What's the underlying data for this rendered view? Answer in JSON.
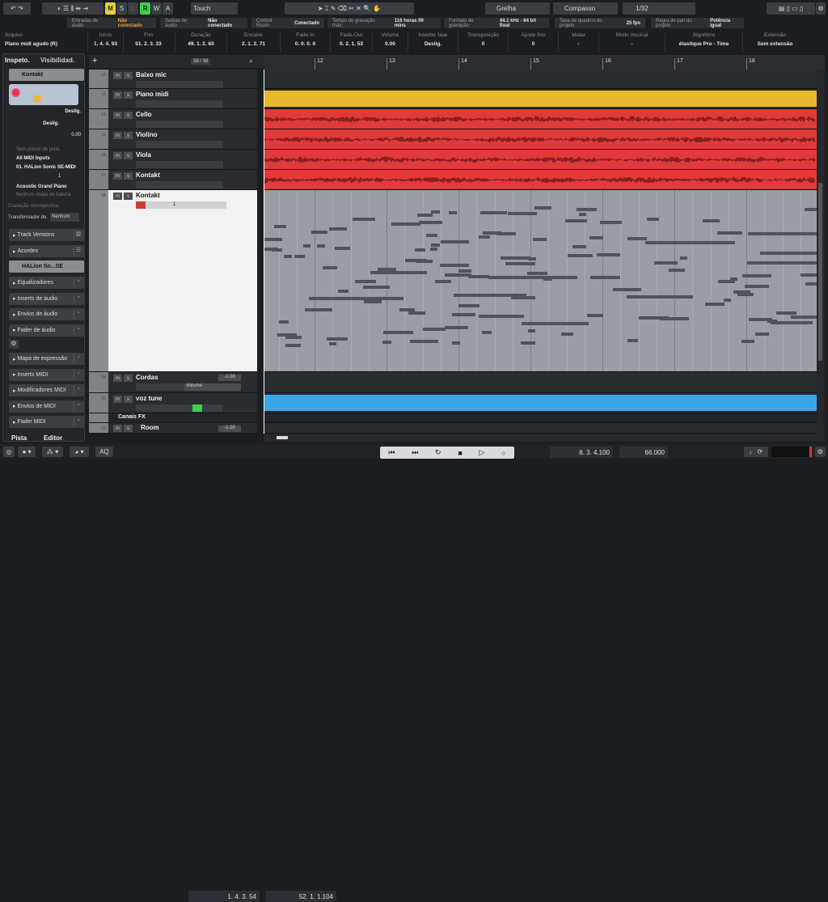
{
  "toolbar": {
    "automation_mode": "Touch",
    "mswra": [
      "M",
      "S",
      "L",
      "R",
      "W",
      "A"
    ],
    "snap_type": "Grelha",
    "grid_type": "Compasso",
    "quantize": "1/32"
  },
  "status": [
    {
      "label": "Entradas de áudio",
      "value": "Não conectado"
    },
    {
      "label": "Saídas de áudio",
      "value": "Não conectado"
    },
    {
      "label": "Control Room",
      "value": "Conectado"
    },
    {
      "label": "Tempo de gravação máx.",
      "value": "116 horas 09 mins"
    },
    {
      "label": "Formato de gravação",
      "value": "44.1 kHz - 64 bit float"
    },
    {
      "label": "Taxa de quadros do projeto",
      "value": "25 fps"
    },
    {
      "label": "Regra de pan do projeto",
      "value": "Potência igual"
    }
  ],
  "infoline": [
    {
      "label": "Arquivo",
      "value": "Piano midi agudo (R)"
    },
    {
      "label": "Início",
      "value": "1. 4. 4. 93"
    },
    {
      "label": "Fim",
      "value": "51. 2. 3. 33"
    },
    {
      "label": "Duração",
      "value": "49. 1. 2. 60"
    },
    {
      "label": "Encaixe",
      "value": "2. 1. 2. 71"
    },
    {
      "label": "Fade-In",
      "value": "0. 0. 0. 0"
    },
    {
      "label": "Fade-Out",
      "value": "0. 2. 1. 53"
    },
    {
      "label": "Volume",
      "value": "0.00",
      "unit": "dB"
    },
    {
      "label": "Inverter fase",
      "value": "Deslig."
    },
    {
      "label": "Transposição",
      "value": "0"
    },
    {
      "label": "Ajuste fino",
      "value": "0"
    },
    {
      "label": "Mutar",
      "value": "-"
    },
    {
      "label": "Modo musical",
      "value": "-"
    },
    {
      "label": "Algoritmo",
      "value": "élastique Pro - Time"
    },
    {
      "label": "Extensão",
      "value": "Sem extensão"
    }
  ],
  "inspector": {
    "tabs": [
      "Inspeto.",
      "Visibilidad."
    ],
    "track_name": "Kontakt",
    "volume": "Deslig.",
    "pan": "Deslig.",
    "delay": "0.00",
    "preset": "Sem preset de pista",
    "input": "All MIDI Inputs",
    "output": "01. HALion Sonic SE-MIDI",
    "channel": "1",
    "program": "Acoustic Grand Piano",
    "drum_map": "Nenhum mapa de bateria",
    "retro": "Gravação retrospectiva",
    "transformer_label": "Transformador de.",
    "transformer_value": "Nenhum",
    "sections": [
      "Track Versions",
      "Acordes"
    ],
    "instrument": "HALion So...SE",
    "inst_sections": [
      "Equalizadores",
      "Inserts de áudio",
      "Envios de áudio",
      "Fader de áudio"
    ],
    "midi_sections": [
      "Mapa de expressão",
      "Inserts MIDI",
      "Modificadores MIDI",
      "Envios de MIDI",
      "Fader MIDI"
    ],
    "bottom_tabs": [
      "Pista",
      "Editor"
    ]
  },
  "tracklist": {
    "count": "38 / 38",
    "tracks": [
      {
        "n": "12",
        "name": "Baixo mic"
      },
      {
        "n": "13",
        "name": "Piano midi"
      },
      {
        "n": "14",
        "name": "Cello"
      },
      {
        "n": "15",
        "name": "Violino"
      },
      {
        "n": "16",
        "name": "Viola"
      },
      {
        "n": "17",
        "name": "Kontakt"
      },
      {
        "n": "18",
        "name": "Kontakt",
        "channel": "1"
      },
      {
        "n": "19",
        "name": "Cordas",
        "value": "-1.00",
        "param": "Volume"
      },
      {
        "n": "20",
        "name": "voz tune"
      },
      {
        "name": "Canais FX"
      },
      {
        "n": "21",
        "name": "Room",
        "value": "-1.00"
      }
    ]
  },
  "ruler": [
    "12",
    "13",
    "14",
    "15",
    "16",
    "17",
    "18"
  ],
  "colors": {
    "yellow": "#e8b92c",
    "red": "#e03a3a",
    "blue": "#3aa6e8",
    "midi_bg": "#9a9da1"
  },
  "transport": {
    "left_locator": "1. 4. 3. 54",
    "right_locator": "52. 1. 1.104",
    "position": "8. 3. 4.100",
    "tempo": "66.000",
    "aq": "AQ"
  }
}
